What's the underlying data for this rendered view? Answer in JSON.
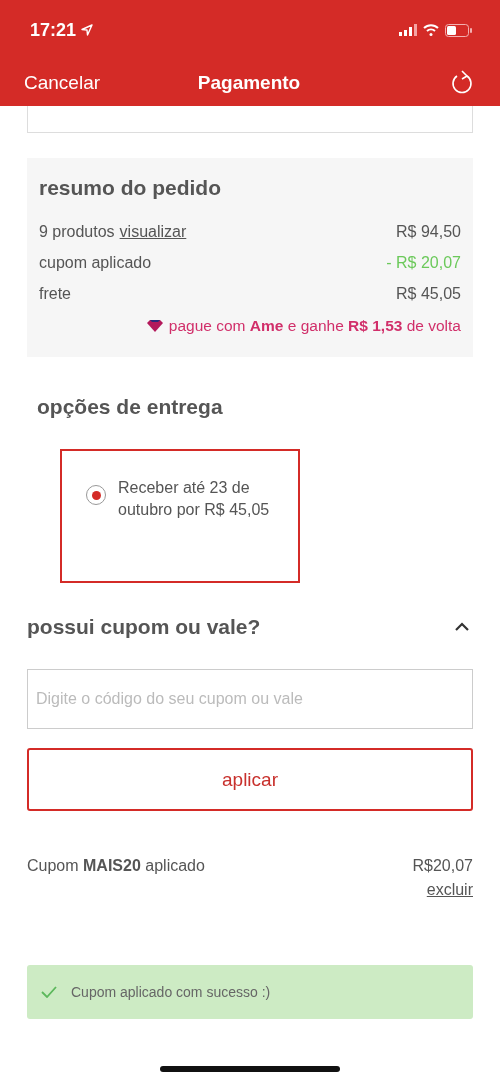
{
  "status_bar": {
    "time": "17:21"
  },
  "nav": {
    "cancel": "Cancelar",
    "title": "Pagamento"
  },
  "summary": {
    "title": "resumo do pedido",
    "rows": [
      {
        "label": "9 produtos",
        "link": "visualizar",
        "value": "R$ 94,50",
        "kind": "normal"
      },
      {
        "label": "cupom aplicado",
        "value": "- R$ 20,07",
        "kind": "discount"
      },
      {
        "label": "frete",
        "value": "R$ 45,05",
        "kind": "normal"
      }
    ],
    "cashback": "pague com **Ame** e ganhe **R$ 1,53** de volta"
  },
  "delivery": {
    "title": "opções de entrega",
    "options": [
      {
        "label": "Receber até 23 de outubro por R$ 45,05",
        "selected": true
      }
    ]
  },
  "coupon": {
    "title": "possui cupom ou vale?",
    "expanded": true,
    "placeholder": "Digite o código do seu cupom ou vale",
    "button": "aplicar",
    "applied": {
      "text": "Cupom **MAIS20** aplicado",
      "value": "R$20,07",
      "remove": "excluir"
    }
  },
  "toast": {
    "text": "Cupom aplicado com sucesso :)"
  }
}
